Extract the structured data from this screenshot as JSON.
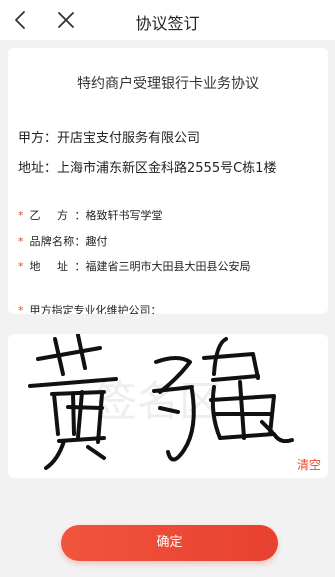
{
  "header": {
    "title": "协议签订"
  },
  "agreement": {
    "title": "特约商户受理银行卡业务协议",
    "party_a_label": "甲方：",
    "party_a_name": "开店宝支付服务有限公司",
    "address_label": "地址：",
    "address_value": "上海市浦东新区金科路2555号C栋1楼",
    "fields": [
      {
        "label": "乙  方：",
        "value": "格致轩书写学堂"
      },
      {
        "label": "品牌名称：",
        "value": "趣付"
      },
      {
        "label": "地  址：",
        "value": "福建省三明市大田县大田县公安局"
      },
      {
        "label": "甲方指定专业化维护公司：",
        "value": ""
      }
    ]
  },
  "signature": {
    "clear_label": "清空",
    "watermark_text": "签名区",
    "ink_color": "#111111",
    "handwritten_text": "黄强"
  },
  "footer": {
    "confirm_label": "确定"
  },
  "colors": {
    "accent": "#e8412f",
    "background": "#f2f2f2"
  }
}
